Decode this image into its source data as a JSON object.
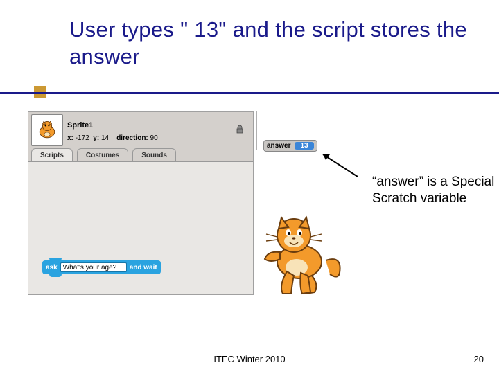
{
  "title": "User types \" 13\" and the script stores the answer",
  "sprite": {
    "name": "Sprite1",
    "x_label": "x:",
    "x": "-172",
    "y_label": "y:",
    "y": "14",
    "dir_label": "direction:",
    "dir": "90"
  },
  "tabs": {
    "scripts": "Scripts",
    "costumes": "Costumes",
    "sounds": "Sounds"
  },
  "ask_block": {
    "prefix": "ask",
    "value": "What's your age?",
    "suffix": "and wait"
  },
  "monitor": {
    "label": "answer",
    "value": "13"
  },
  "annotation": "“answer” is a Special Scratch variable",
  "footer": {
    "center": "ITEC Winter 2010",
    "page": "20"
  }
}
